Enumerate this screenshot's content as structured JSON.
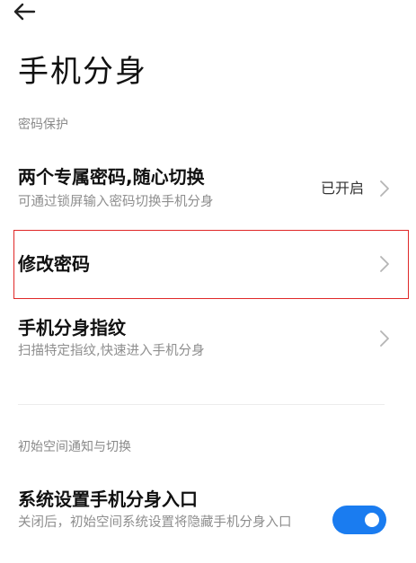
{
  "page": {
    "title": "手机分身"
  },
  "sections": {
    "password_protection": {
      "header": "密码保护",
      "items": [
        {
          "title": "两个专属密码,随心切换",
          "subtitle": "可通过锁屏输入密码切换手机分身",
          "value": "已开启"
        },
        {
          "title": "修改密码"
        },
        {
          "title": "手机分身指纹",
          "subtitle": "扫描特定指纹,快速进入手机分身"
        }
      ]
    },
    "initial_space": {
      "header": "初始空间通知与切换",
      "items": [
        {
          "title": "系统设置手机分身入口",
          "subtitle": "关闭后，初始空间系统设置将隐藏手机分身入口",
          "toggle_on": true
        }
      ]
    }
  },
  "colors": {
    "accent": "#1a7cf0",
    "highlight": "#e02828"
  },
  "icons": {
    "back": "arrow-left-icon",
    "chevron": "chevron-right-icon"
  }
}
